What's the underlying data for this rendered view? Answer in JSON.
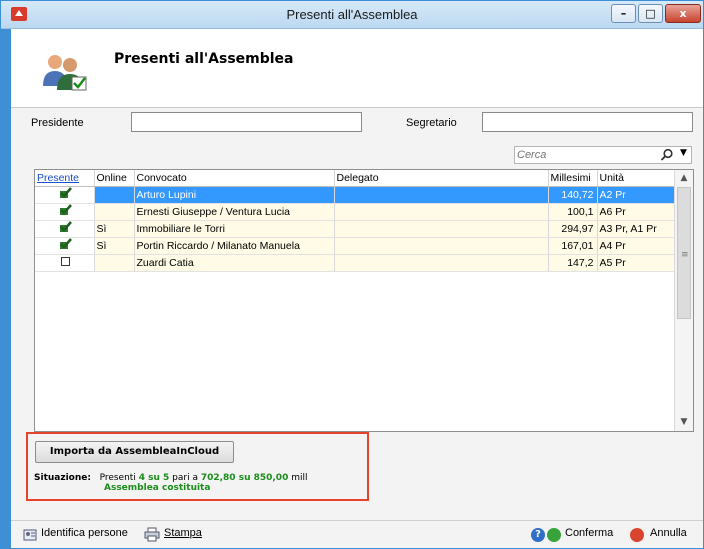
{
  "window": {
    "title": "Presenti all'Assemblea",
    "minimize": "–",
    "maximize": "□",
    "close": "x"
  },
  "header": {
    "title": "Presenti all'Assemblea"
  },
  "form": {
    "presidente_label": "Presidente",
    "presidente_value": "",
    "segretario_label": "Segretario",
    "segretario_value": ""
  },
  "search": {
    "placeholder": "Cerca",
    "icon": "search-icon",
    "dropdown": "▼"
  },
  "grid": {
    "columns": [
      "Presente",
      "Online",
      "Convocato",
      "Delegato",
      "Millesimi",
      "Unità"
    ],
    "rows": [
      {
        "presente": true,
        "online": "",
        "convocato": "Arturo Lupini",
        "delegato": "",
        "millesimi": "140,72",
        "unita": "A2 Pr",
        "selected": true
      },
      {
        "presente": true,
        "online": "",
        "convocato": "Ernesti Giuseppe / Ventura Lucia",
        "delegato": "",
        "millesimi": "100,1",
        "unita": "A6 Pr",
        "selected": false
      },
      {
        "presente": true,
        "online": "Sì",
        "convocato": "Immobiliare le Torri",
        "delegato": "",
        "millesimi": "294,97",
        "unita": "A3 Pr, A1 Pr",
        "selected": false
      },
      {
        "presente": true,
        "online": "Sì",
        "convocato": "Portin Riccardo / Milanato Manuela",
        "delegato": "",
        "millesimi": "167,01",
        "unita": "A4 Pr",
        "selected": false
      },
      {
        "presente": false,
        "online": "",
        "convocato": "Zuardi Catia",
        "delegato": "",
        "millesimi": "147,2",
        "unita": "A5 Pr",
        "selected": false
      }
    ]
  },
  "import_button": "Importa da AssembleaInCloud",
  "situazione": {
    "label": "Situazione:",
    "text1": "Presenti",
    "count": "4 su 5",
    "text2": "pari a",
    "mill": "702,80 su 850,00",
    "text3": "mill",
    "status": "Assemblea costituita"
  },
  "footer": {
    "identifica": "Identifica persone",
    "stampa": "Stampa",
    "conferma": "Conferma",
    "annulla": "Annulla"
  },
  "colors": {
    "selected_row": "#3399ff",
    "row_bg": "#fffbe6",
    "green": "#1a8d1a",
    "highlight_border": "#e3442b"
  }
}
